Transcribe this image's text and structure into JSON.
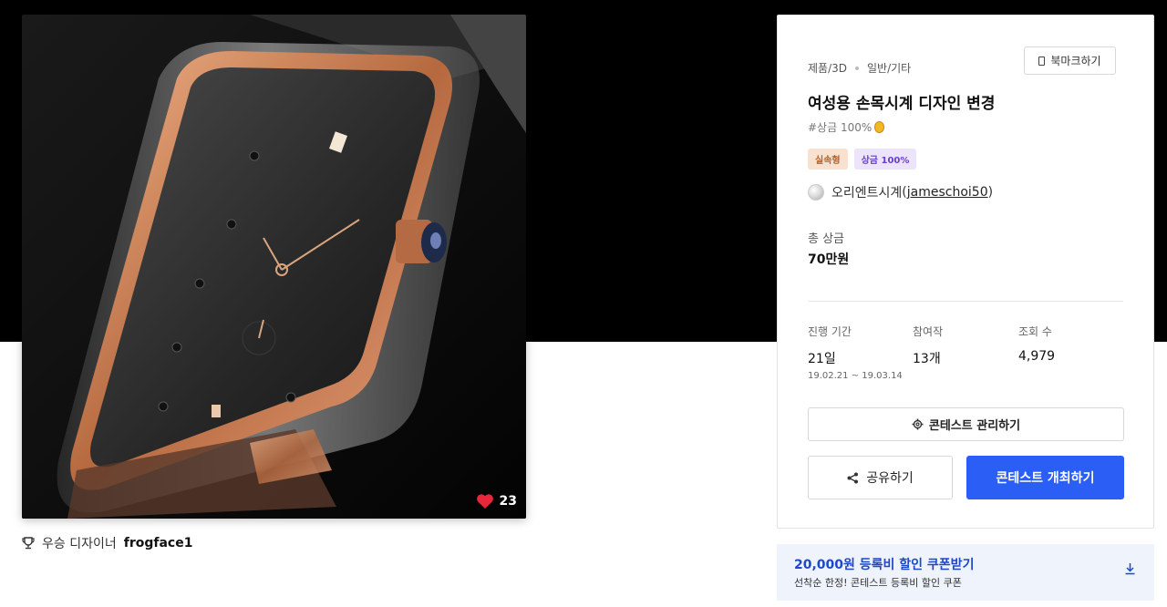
{
  "hero": {
    "likes_count": "23",
    "heart_color": "#e8283a"
  },
  "winner": {
    "label": "우승 디자이너",
    "name": "frogface1"
  },
  "contest": {
    "category_main": "제품/3D",
    "category_sub": "일반/기타",
    "bookmark_label": "북마크하기",
    "title": "여성용 손목시계 디자인 변경",
    "hashtag": "#상금 100%",
    "badges": [
      "실속형",
      "상금 100%"
    ],
    "host_name": "오리엔트시계",
    "host_id": "jameschoi50",
    "prize_label": "총 상금",
    "prize_value": "70만원",
    "stats": {
      "period_label": "진행 기간",
      "period_value": "21일",
      "period_dates": "19.02.21 ~ 19.03.14",
      "entries_label": "참여작",
      "entries_value": "13개",
      "views_label": "조회 수",
      "views_value": "4,979"
    },
    "manage_label": "콘테스트 관리하기",
    "share_label": "공유하기",
    "host_contest_label": "콘테스트 개최하기",
    "accent_color": "#2b5ef5"
  },
  "coupon": {
    "title": "20,000원 등록비 할인 쿠폰받기",
    "subtitle": "선착순 한정! 콘테스트 등록비 할인 쿠폰"
  }
}
